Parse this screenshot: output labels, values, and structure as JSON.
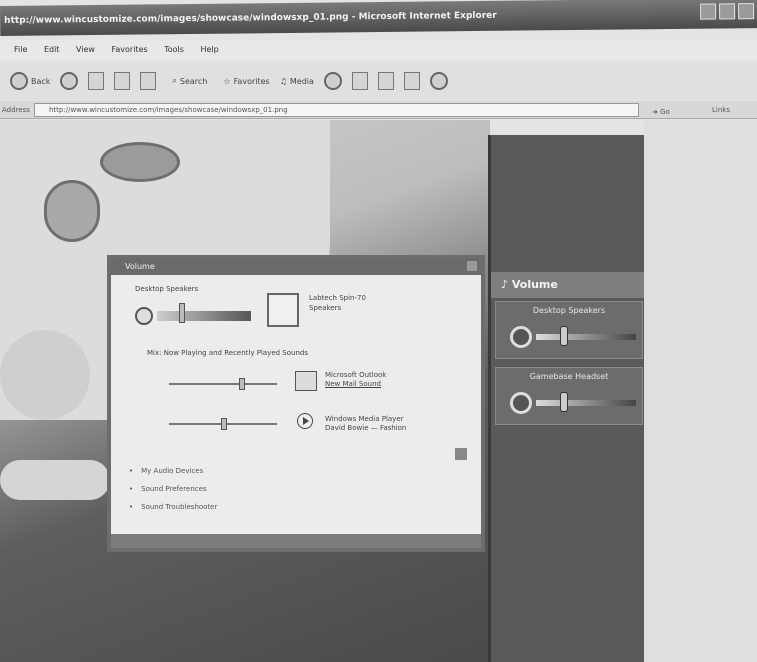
{
  "browser": {
    "title": "http://www.wincustomize.com/images/showcase/windowsxp_01.png - Microsoft Internet Explorer",
    "menu": [
      "File",
      "Edit",
      "View",
      "Favorites",
      "Tools",
      "Help"
    ],
    "toolbar": {
      "back": "Back",
      "search": "Search",
      "favorites": "Favorites",
      "media": "Media"
    },
    "address_label": "Address",
    "address_value": "http://www.wincustomize.com/images/showcase/windowsxp_01.png",
    "go_label": "Go",
    "links_label": "Links"
  },
  "volume_dialog": {
    "title": "Volume",
    "desktop_speakers_label": "Desktop Speakers",
    "device_name": "Labtech Spin-70 Speakers",
    "playing_header": "Mix: Now Playing and Recently Played Sounds",
    "apps": [
      {
        "name": "Microsoft Outlook",
        "detail": "New Mail Sound"
      },
      {
        "name": "Windows Media Player",
        "detail": "David Bowie — Fashion"
      }
    ],
    "links": [
      "My Audio Devices",
      "Sound Preferences",
      "Sound Troubleshooter"
    ]
  },
  "sidebar": {
    "header": "Volume",
    "panels": [
      {
        "label": "Desktop Speakers",
        "level": 0.25
      },
      {
        "label": "Gamebase Headset",
        "level": 0.25
      }
    ]
  }
}
